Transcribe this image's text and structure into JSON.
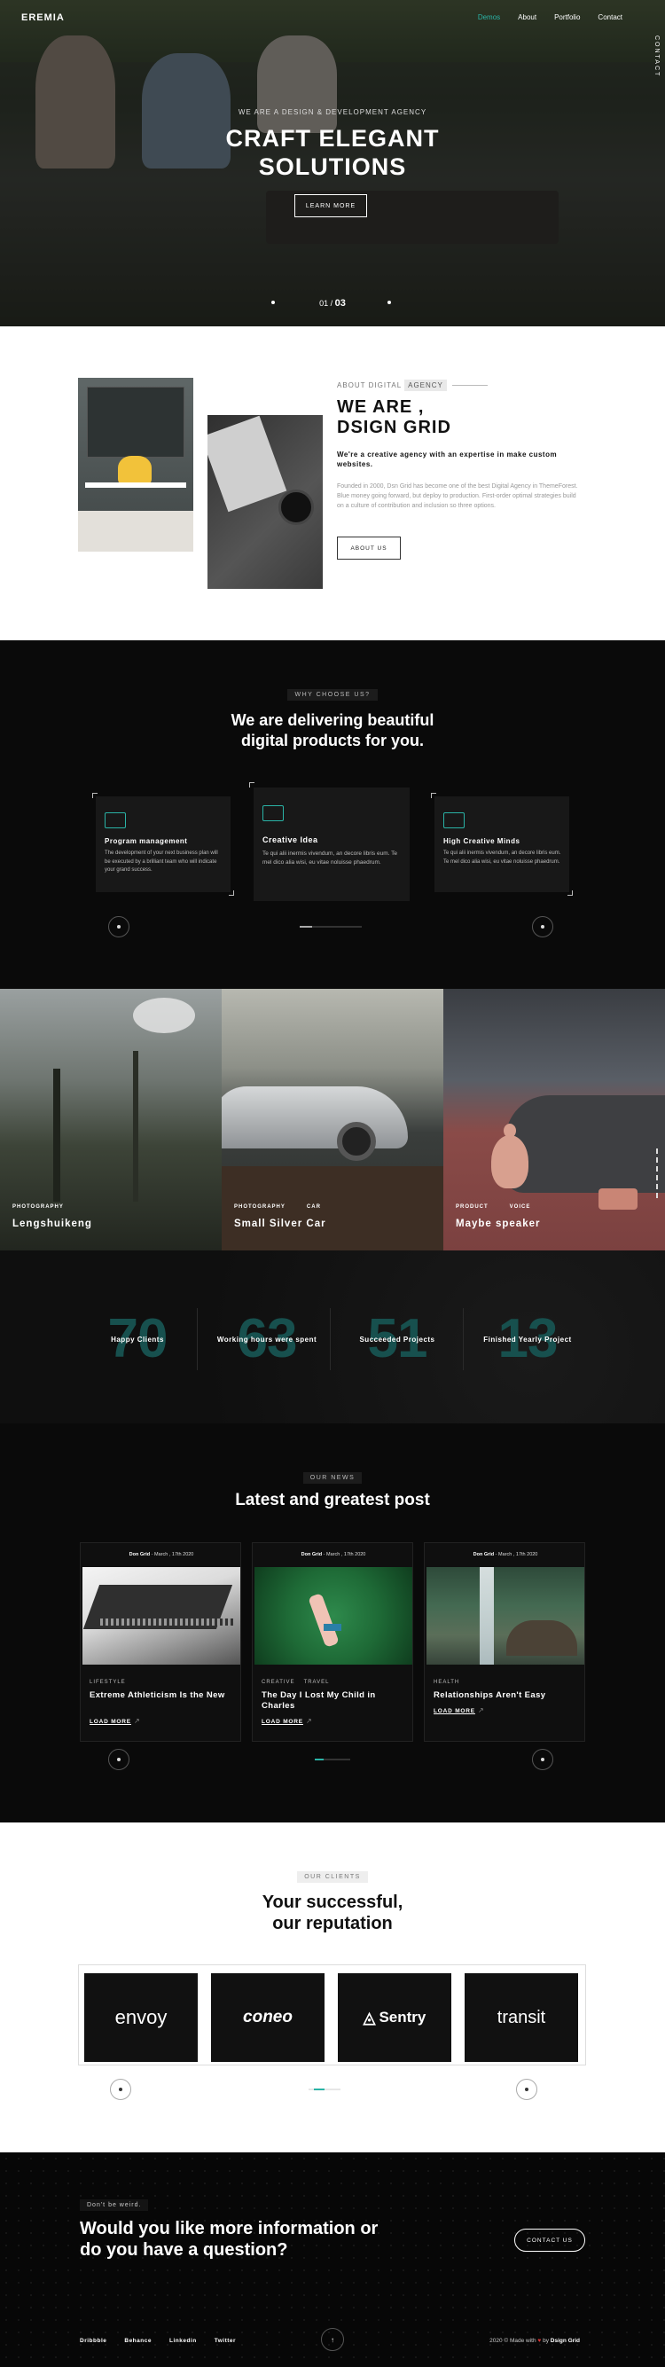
{
  "header": {
    "logo": "EREMIA",
    "nav": [
      "Demos",
      "About",
      "Portfolio",
      "Contact"
    ],
    "side_label": "CONTACT"
  },
  "hero": {
    "subtitle": "WE ARE A DESIGN & DEVELOPMENT AGENCY",
    "title_line1": "CRAFT ELEGANT",
    "title_line2": "SOLUTIONS",
    "button": "LEARN MORE",
    "slide_current": "01",
    "slide_total": "03"
  },
  "about": {
    "kicker": "ABOUT DIGITAL",
    "kicker_highlight": "AGENCY",
    "title_line1": "WE ARE ,",
    "title_line2": "DSIGN GRID",
    "lead": "We're a creative agency with an expertise in make custom websites.",
    "body": "Founded in 2000, Dsn Grid has become one of the best Digital Agency in ThemeForest. Blue money going forward, but deploy to production. First-order optimal strategies build on a culture of contribution and inclusion so three options.",
    "button": "ABOUT US"
  },
  "why": {
    "tag": "WHY CHOOSE US?",
    "title_line1": "We are delivering beautiful",
    "title_line2": "digital products for you.",
    "cards": [
      {
        "icon": "code-icon",
        "title": "Program management",
        "text": "The development of your next business plan will be executed by a brilliant team who will indicate your grand success."
      },
      {
        "icon": "image-icon",
        "title": "Creative Idea",
        "text": "Te qui alii inermis vivendum, an decore libris eum. Te mel dico alia wisi, eu vitae noluisse phaedrum."
      },
      {
        "icon": "chart-icon",
        "title": "High Creative Minds",
        "text": "Te qui alii inermis vivendum, an decore libris eum. Te mel dico alia wisi, eu vitae noluisse phaedrum."
      }
    ]
  },
  "portfolio": [
    {
      "cats": [
        "PHOTOGRAPHY"
      ],
      "name": "Lengshuikeng"
    },
    {
      "cats": [
        "PHOTOGRAPHY",
        "CAR"
      ],
      "name": "Small Silver Car"
    },
    {
      "cats": [
        "PRODUCT",
        "VOICE"
      ],
      "name": "Maybe speaker"
    }
  ],
  "stats": [
    {
      "num": "70",
      "label": "Happy Clients"
    },
    {
      "num": "63",
      "label": "Working hours were spent"
    },
    {
      "num": "51",
      "label": "Succeeded Projects"
    },
    {
      "num": "13",
      "label": "Finished Yearly Project"
    }
  ],
  "news": {
    "tag": "OUR NEWS",
    "title": "Latest and greatest post",
    "posts": [
      {
        "author": "Don Grid",
        "date": "- March , 17th 2020",
        "cats": [
          "LIFESTYLE"
        ],
        "title": "Extreme Athleticism Is the New",
        "more": "LOAD MORE"
      },
      {
        "author": "Don Grid",
        "date": "- March , 17th 2020",
        "cats": [
          "CREATIVE",
          "TRAVEL"
        ],
        "title": "The Day I Lost My Child in Charles",
        "more": "LOAD MORE"
      },
      {
        "author": "Don Grid",
        "date": "- March , 17th 2020",
        "cats": [
          "HEALTH"
        ],
        "title": "Relationships Aren't Easy",
        "more": "LOAD MORE"
      }
    ]
  },
  "clients": {
    "tag": "OUR CLIENTS",
    "title_line1": "Your successful,",
    "title_line2": "our reputation",
    "logos": [
      "envoy",
      "coneo",
      "Sentry",
      "transit"
    ]
  },
  "contact": {
    "kicker": "Don't be weird.",
    "title_line1": "Would you like more information or",
    "title_line2": "do you have a question?",
    "button": "CONTACT US",
    "social": [
      "Dribbble",
      "Behance",
      "Linkedin",
      "Twitter"
    ],
    "copy_prefix": "2020 © Made with",
    "copy_heart": "♥",
    "copy_by": "by",
    "copy_brand": "Dsign Grid"
  },
  "colors": {
    "accent": "#2ab3a6",
    "dark": "#0a0a0a"
  }
}
